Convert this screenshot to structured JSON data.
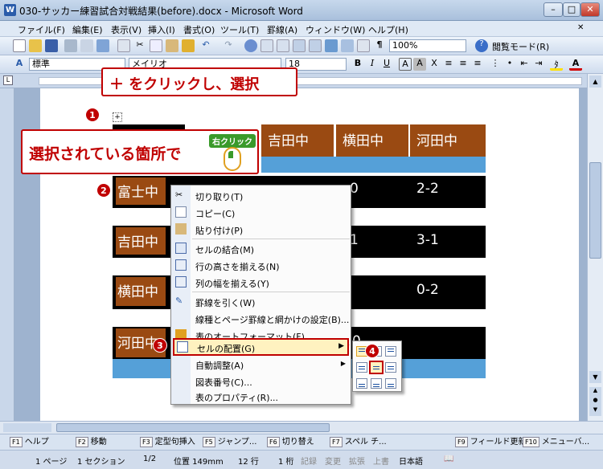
{
  "window": {
    "title": "030-サッカー練習試合対戦結果(before).docx - Microsoft Word"
  },
  "menu": [
    "ファイル(F)",
    "編集(E)",
    "表示(V)",
    "挿入(I)",
    "書式(O)",
    "ツール(T)",
    "罫線(A)",
    "ウィンドウ(W)",
    "ヘルプ(H)"
  ],
  "toolbar": {
    "zoom": "100%",
    "reading_mode": "閲覧モード(R)"
  },
  "format_toolbar": {
    "style": "標準",
    "font": "メイリオ",
    "size": "18"
  },
  "table": {
    "header": [
      "吉田中",
      "横田中",
      "河田中"
    ],
    "rows": [
      {
        "team": "富士中",
        "scores": [
          "0",
          "2-2"
        ]
      },
      {
        "team": "吉田中",
        "scores": [
          "1",
          "3-1"
        ]
      },
      {
        "team": "横田中",
        "scores": [
          "0-2"
        ]
      },
      {
        "team": "河田中",
        "scores": [
          "0"
        ]
      }
    ]
  },
  "context_menu": {
    "items": [
      {
        "label": "切り取り(T)",
        "icon": "scissors-icon"
      },
      {
        "label": "コピー(C)",
        "icon": "copy-icon"
      },
      {
        "label": "貼り付け(P)",
        "icon": "paste-icon"
      },
      {
        "label": "セルの結合(M)",
        "icon": "merge-cells-icon"
      },
      {
        "label": "行の高さを揃える(N)",
        "icon": "row-height-icon"
      },
      {
        "label": "列の幅を揃える(Y)",
        "icon": "column-width-icon"
      },
      {
        "label": "罫線を引く(W)",
        "icon": "pencil-icon"
      },
      {
        "label": "線種とページ罫線と網かけの設定(B)...",
        "icon": ""
      },
      {
        "label": "表のオートフォーマット(F)...",
        "icon": "autoformat-icon"
      },
      {
        "label": "セルの配置(G)",
        "icon": "cell-alignment-icon"
      },
      {
        "label": "自動調整(A)",
        "icon": ""
      },
      {
        "label": "図表番号(C)...",
        "icon": ""
      },
      {
        "label": "表のプロパティ(R)...",
        "icon": ""
      }
    ]
  },
  "annotations": {
    "step1": "＋ をクリックし、選択",
    "step2": "選択されている箇所で",
    "right_click": "右クリック",
    "badges": [
      "1",
      "2",
      "3",
      "4"
    ]
  },
  "function_keys": [
    {
      "key": "F1",
      "label": "ヘルプ"
    },
    {
      "key": "F2",
      "label": "移動"
    },
    {
      "key": "F3",
      "label": "定型句挿入"
    },
    {
      "key": "F5",
      "label": "ジャンプ..."
    },
    {
      "key": "F6",
      "label": "切り替え"
    },
    {
      "key": "F7",
      "label": "スペル チ..."
    },
    {
      "key": "F9",
      "label": "フィールド更新"
    },
    {
      "key": "F10",
      "label": "メニューバ..."
    }
  ],
  "status": {
    "page": "1 ページ",
    "section": "1 セクション",
    "pages": "1/2",
    "position": "位置 149mm",
    "line": "12 行",
    "col": "1 桁",
    "rec": "記録",
    "trk": "変更",
    "ext": "拡張",
    "ovr": "上書",
    "lang": "日本語"
  },
  "colors": {
    "brown": "#9a4a12",
    "blue": "#55a0d8",
    "accent_red": "#c00000",
    "highlight": "#fff2c0"
  }
}
